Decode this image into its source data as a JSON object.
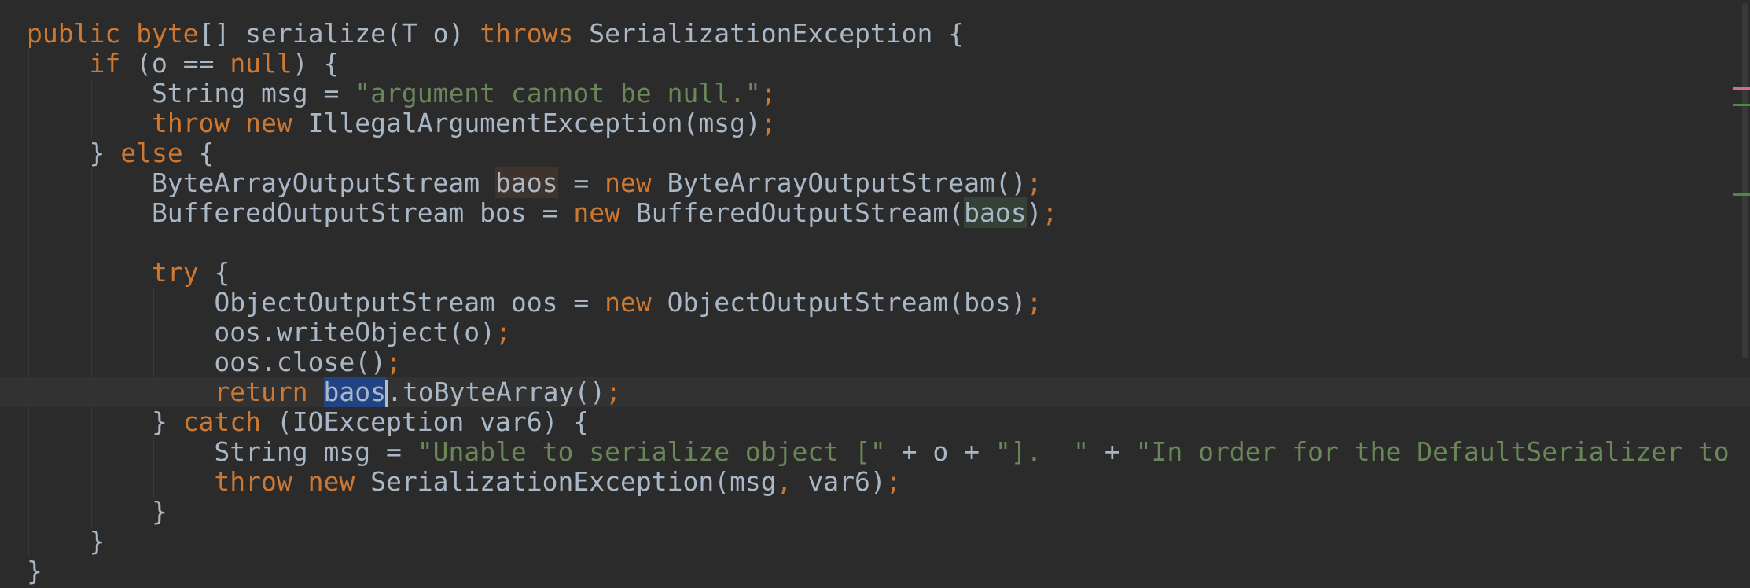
{
  "editor": {
    "language": "java",
    "lines": [
      [
        [
          "public ",
          "kw"
        ],
        [
          "byte",
          "kw"
        ],
        [
          "[] serialize(T o) ",
          ""
        ],
        [
          "throws ",
          "kw"
        ],
        [
          "SerializationException {",
          ""
        ]
      ],
      [
        [
          "    ",
          ""
        ],
        [
          "if ",
          "kw"
        ],
        [
          "(o == ",
          ""
        ],
        [
          "null",
          "kw"
        ],
        [
          ") {",
          ""
        ]
      ],
      [
        [
          "        String msg = ",
          ""
        ],
        [
          "\"argument cannot be null.\"",
          "str"
        ],
        [
          ";",
          "punc"
        ]
      ],
      [
        [
          "        ",
          ""
        ],
        [
          "throw new ",
          "kw"
        ],
        [
          "IllegalArgumentException(msg)",
          ""
        ],
        [
          ";",
          "punc"
        ]
      ],
      [
        [
          "    } ",
          ""
        ],
        [
          "else ",
          "kw"
        ],
        [
          "{",
          ""
        ]
      ],
      [
        [
          "        ByteArrayOutputStream ",
          ""
        ],
        [
          "baos",
          "hl-write"
        ],
        [
          " = ",
          ""
        ],
        [
          "new ",
          "kw"
        ],
        [
          "ByteArrayOutputStream()",
          ""
        ],
        [
          ";",
          "punc"
        ]
      ],
      [
        [
          "        BufferedOutputStream bos = ",
          ""
        ],
        [
          "new ",
          "kw"
        ],
        [
          "BufferedOutputStream(",
          ""
        ],
        [
          "baos",
          "hl-read"
        ],
        [
          ")",
          ""
        ],
        [
          ";",
          "punc"
        ]
      ],
      [
        [
          "",
          ""
        ]
      ],
      [
        [
          "        ",
          ""
        ],
        [
          "try ",
          "kw"
        ],
        [
          "{",
          ""
        ]
      ],
      [
        [
          "            ObjectOutputStream oos = ",
          ""
        ],
        [
          "new ",
          "kw"
        ],
        [
          "ObjectOutputStream(bos)",
          ""
        ],
        [
          ";",
          "punc"
        ]
      ],
      [
        [
          "            oos.writeObject(o)",
          ""
        ],
        [
          ";",
          "punc"
        ]
      ],
      [
        [
          "            oos.close()",
          ""
        ],
        [
          ";",
          "punc"
        ]
      ],
      [
        [
          "            ",
          ""
        ],
        [
          "return ",
          "kw"
        ],
        [
          "baos",
          "hl-select"
        ],
        [
          "|caret|",
          "caret"
        ],
        [
          ".toByteArray()",
          ""
        ],
        [
          ";",
          "punc"
        ]
      ],
      [
        [
          "        } ",
          ""
        ],
        [
          "catch ",
          "kw"
        ],
        [
          "(IOException var6) {",
          ""
        ]
      ],
      [
        [
          "            String msg = ",
          ""
        ],
        [
          "\"Unable to serialize object [\"",
          "str"
        ],
        [
          " + o + ",
          ""
        ],
        [
          "\"].  \"",
          "str"
        ],
        [
          " + ",
          ""
        ],
        [
          "\"In order for the DefaultSerializer to",
          "str"
        ]
      ],
      [
        [
          "            ",
          ""
        ],
        [
          "throw new ",
          "kw"
        ],
        [
          "SerializationException(msg",
          ""
        ],
        [
          ", ",
          "punc"
        ],
        [
          "var6)",
          ""
        ],
        [
          ";",
          "punc"
        ]
      ],
      [
        [
          "        }",
          ""
        ]
      ],
      [
        [
          "    }",
          ""
        ]
      ],
      [
        [
          "}",
          ""
        ]
      ]
    ],
    "caret_line_index": 12
  },
  "colors": {
    "background": "#2b2b2b",
    "text": "#a9b7c6",
    "keyword": "#cc7832",
    "string": "#6a8759",
    "selection": "#214283",
    "write_usage_highlight": "#40332b",
    "read_usage_highlight": "#344134",
    "caret_row": "#323232"
  },
  "markers": [
    {
      "color": "#d76a8f"
    },
    {
      "color": "#4a8a43"
    },
    {
      "color": "#4a8a43"
    }
  ]
}
